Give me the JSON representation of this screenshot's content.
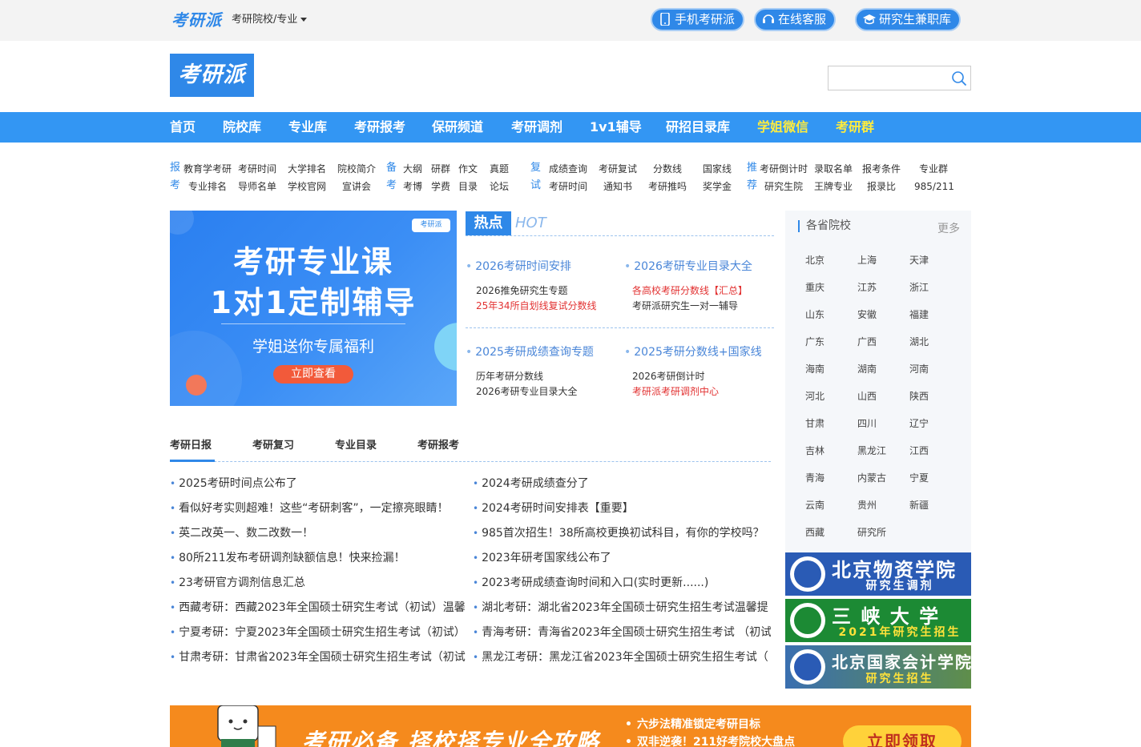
{
  "topbar": {
    "brand": "考研派",
    "school_menu": "考研院校/专业",
    "buttons": [
      {
        "label": "手机考研派",
        "icon": "phone-icon"
      },
      {
        "label": "在线客服",
        "icon": "headset-icon"
      },
      {
        "label": "研究生兼职库",
        "icon": "graduation-cap-icon"
      }
    ]
  },
  "header": {
    "logo": "考研派",
    "search": {
      "placeholder": "",
      "value": ""
    }
  },
  "nav": {
    "items": [
      "首页",
      "院校库",
      "专业库",
      "考研报考",
      "保研频道",
      "考研调剂",
      "1v1辅导",
      "研招目录库",
      "学姐微信",
      "考研群"
    ]
  },
  "quicklinks": {
    "bao": "报",
    "kao": "考",
    "bei": "备",
    "kao2": "考",
    "fu": "复",
    "shi": "试",
    "tui": "推",
    "jian": "荐",
    "row1": [
      "教育学考研",
      "考研时间",
      "大学排名",
      "院校简介",
      "大纲",
      "研群",
      "作文",
      "真题",
      "成绩查询",
      "考研复试",
      "分数线",
      "国家线",
      "考研倒计时",
      "录取名单",
      "报考条件",
      "专业群"
    ],
    "row2": [
      "专业排名",
      "导师名单",
      "学校官网",
      "宣讲会",
      "考博",
      "学费",
      "目录",
      "论坛",
      "考研时间",
      "通知书",
      "考研推吗",
      "奖学金",
      "研究生院",
      "王牌专业",
      "报录比",
      "985/211"
    ]
  },
  "banner": {
    "badge": "考研派",
    "title1": "考研专业课",
    "title2": "1对1定制辅导",
    "subtitle": "学姐送你专属福利",
    "button": "立即查看"
  },
  "hot": {
    "tag": "热点",
    "tag_en": "HOT",
    "blocks": [
      {
        "title": "2026考研时间安排",
        "lines": [
          {
            "text": "2026推免研究生专题",
            "red": false
          },
          {
            "text": "25年34所自划线复试分数线",
            "red": true
          }
        ]
      },
      {
        "title": "2026考研专业目录大全",
        "lines": [
          {
            "text": "各高校考研分数线【汇总】",
            "red": true
          },
          {
            "text": "考研派研究生一对一辅导",
            "red": false
          }
        ]
      },
      {
        "title": "2025考研成绩查询专题",
        "lines": [
          {
            "text": "历年考研分数线",
            "red": false
          },
          {
            "text": "2026考研专业目录大全",
            "red": false
          }
        ]
      },
      {
        "title": "2025考研分数线+国家线",
        "lines": [
          {
            "text": "2026考研倒计时",
            "red": false
          },
          {
            "text": "考研派考研调剂中心",
            "red": true
          }
        ]
      }
    ]
  },
  "tabs": [
    "考研日报",
    "考研复习",
    "专业目录",
    "考研报考"
  ],
  "news": {
    "left": [
      "2025考研时间点公布了",
      "看似好考实则超难！这些“考研刺客”，一定擦亮眼睛！",
      "英二改英一、数二改数一！",
      "80所211发布考研调剂缺额信息！快来捡漏！",
      "23考研官方调剂信息汇总",
      "西藏考研：西藏2023年全国硕士研究生考试（初试）温馨",
      "宁夏考研：宁夏2023年全国硕士研究生招生考试（初试）",
      "甘肃考研：甘肃省2023年全国硕士研究生招生考试（初试"
    ],
    "right": [
      "2024考研成绩查分了",
      "2024考研时间安排表【重要】",
      "985首次招生！38所高校更换初试科目，有你的学校吗？",
      "2023年研考国家线公布了",
      "2023考研成绩查询时间和入口(实时更新......)",
      "湖北考研：湖北省2023年全国硕士研究生招生考试温馨提",
      "青海考研：青海省2023年全国硕士研究生招生考试 （初试",
      "黑龙江考研：黑龙江省2023年全国硕士研究生招生考试（"
    ]
  },
  "provinces": {
    "title": "各省院校",
    "more": "更多",
    "list": [
      "北京",
      "上海",
      "天津",
      "重庆",
      "江苏",
      "浙江",
      "山东",
      "安徽",
      "福建",
      "广东",
      "广西",
      "湖北",
      "海南",
      "湖南",
      "河南",
      "河北",
      "山西",
      "陕西",
      "甘肃",
      "四川",
      "辽宁",
      "吉林",
      "黑龙江",
      "江西",
      "青海",
      "内蒙古",
      "宁夏",
      "云南",
      "贵州",
      "新疆",
      "西藏",
      "研究所"
    ]
  },
  "ads": [
    {
      "title": "北京物资学院",
      "sub": "研究生调剂",
      "bg": "#2a5bb5",
      "seal": "#2a5bb5",
      "sub_color": "#ffffff"
    },
    {
      "title": "三 峡 大 学",
      "sub": "2021年研究生招生",
      "bg": "#1c8a34",
      "seal": "#1c8a34",
      "sub_color": "#ffe23a"
    },
    {
      "title": "北京国家会计学院",
      "sub": "研究生招生",
      "bg": "#3a6fb0",
      "seal": "#2a5bb5",
      "sub_color": "#ffe23a"
    }
  ],
  "bottom_banner": {
    "headline": "考研必备 择校择专业全攻略",
    "points": [
      "六步法精准锁定考研目标",
      "双非逆袭！211好考院校大盘点"
    ],
    "cta": "立即领取"
  }
}
